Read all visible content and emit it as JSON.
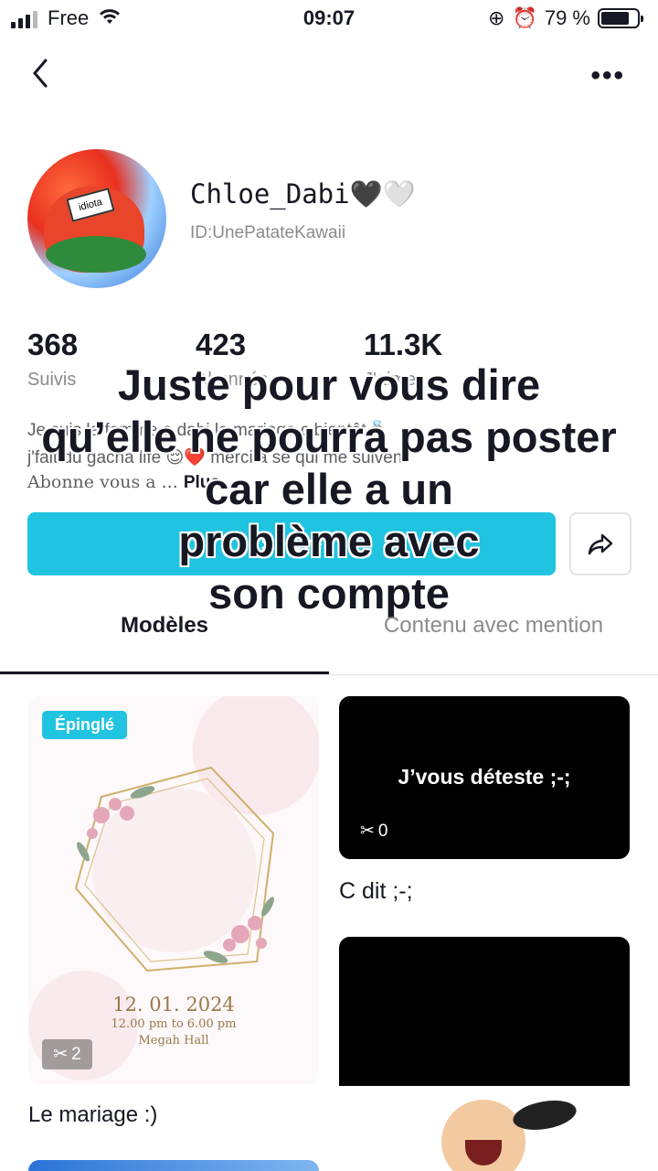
{
  "status_bar": {
    "carrier": "Free",
    "time": "09:07",
    "battery": "79 %",
    "battery_level": 0.79
  },
  "profile": {
    "username": "Chloe_Dabi🖤🤍",
    "id": "ID:UnePatateKawaii",
    "avatar_text": "idiota",
    "stats": [
      {
        "value": "368",
        "label": "Suivis"
      },
      {
        "value": "423",
        "label": "Abonnés"
      },
      {
        "value": "11.3K",
        "label": "J'aime"
      }
    ],
    "bio_line1": "Je suis la femme a dabi le mariage c bientôt💍",
    "bio_line2": "j'fait du gacha life 😌❤️ merci a se qui me suivent",
    "bio_line3": "Abonne vous a ...",
    "bio_more": "Plus",
    "follow_label": "Suivre"
  },
  "overlay": {
    "line1": "Juste pour vous dire",
    "line2": "qu’elle ne pourra pas poster",
    "line3": "car elle a un",
    "line4": "problème avec",
    "line5": "son compte"
  },
  "tabs": [
    {
      "label": "Modèles",
      "active": true
    },
    {
      "label": "Contenu avec mention",
      "active": false
    }
  ],
  "templates": [
    {
      "badge": "Épinglé",
      "uses": "2",
      "date": "12. 01. 2024",
      "time": "12.00 pm to 6.00 pm",
      "place": "Megah Hall",
      "title": "Le mariage :)"
    },
    {
      "preview_text": "J’vous déteste ;-;",
      "uses": "0",
      "title": "C dit ;-;"
    }
  ],
  "colors": {
    "accent": "#20c4e0",
    "text": "#161823",
    "secondary": "#8a8b91"
  }
}
